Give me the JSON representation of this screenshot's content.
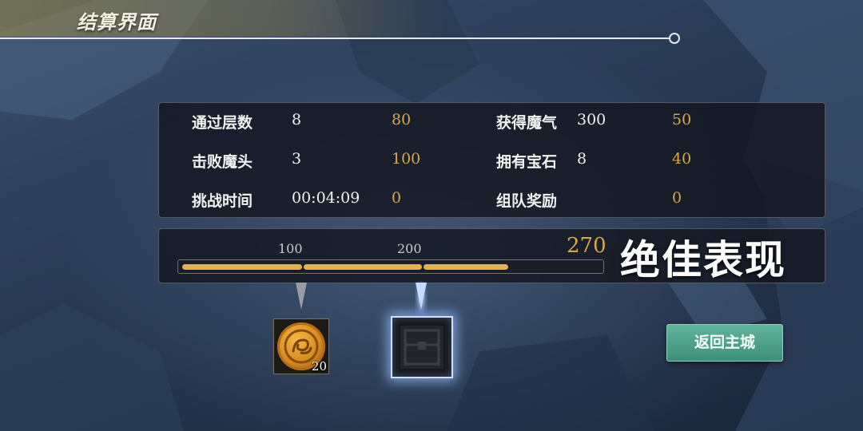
{
  "header": {
    "title": "结算界面"
  },
  "stats": [
    {
      "label": "通过层数",
      "value": "8",
      "score": "80"
    },
    {
      "label": "击败魔头",
      "value": "3",
      "score": "100"
    },
    {
      "label": "挑战时间",
      "value": "00:04:09",
      "score": "0"
    },
    {
      "label": "获得魔气",
      "value": "300",
      "score": "50"
    },
    {
      "label": "拥有宝石",
      "value": "8",
      "score": "40"
    },
    {
      "label": "组队奖励",
      "value": "",
      "score": "0"
    }
  ],
  "performance": {
    "ticks": [
      "100",
      "200"
    ],
    "total_score": "270",
    "rating": "绝佳表现",
    "progress_value": 270
  },
  "rewards": [
    {
      "icon": "gold-coin-icon",
      "count": "20"
    },
    {
      "icon": "locked-chest-icon",
      "count": ""
    }
  ],
  "actions": {
    "return_label": "返回主城"
  },
  "colors": {
    "score": "#d9a64a",
    "bar_fill": "#e2b14c",
    "button": "#4aa087"
  }
}
